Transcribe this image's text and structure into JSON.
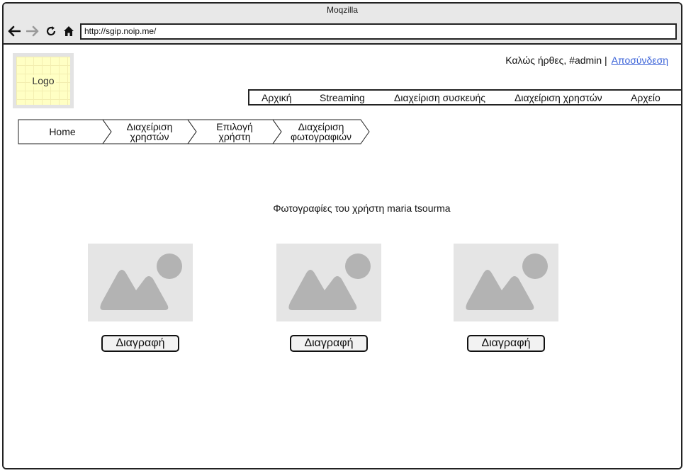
{
  "window": {
    "title": "Moqzilla"
  },
  "browser": {
    "url": "http://sgip.noip.me/"
  },
  "header": {
    "logo_label": "Logo",
    "welcome_text": "Καλώς ήρθες, #admin |",
    "logout_label": "Αποσύνδεση"
  },
  "menu": {
    "items": [
      {
        "label": "Αρχική"
      },
      {
        "label": "Streaming"
      },
      {
        "label": "Διαχείριση συσκευής"
      },
      {
        "label": "Διαχείριση χρηστών"
      },
      {
        "label": "Αρχείο"
      }
    ]
  },
  "breadcrumb": {
    "items": [
      {
        "line1": "Home",
        "line2": ""
      },
      {
        "line1": "Διαχείριση",
        "line2": "χρηστών"
      },
      {
        "line1": "Επιλογή",
        "line2": "χρήστη"
      },
      {
        "line1": "Διαχείριση",
        "line2": "φωτογραφιών"
      }
    ]
  },
  "main": {
    "heading": "Φωτογραφίες του χρήστη maria tsourma",
    "photos": [
      {
        "delete_label": "Διαγραφή"
      },
      {
        "delete_label": "Διαγραφή"
      },
      {
        "delete_label": "Διαγραφή"
      }
    ]
  },
  "icons": {
    "back": "arrow-left-icon",
    "forward": "arrow-right-icon",
    "reload": "reload-icon",
    "home": "home-icon",
    "image": "image-placeholder-icon"
  },
  "colors": {
    "link": "#3a62d8",
    "logo_note": "#ffffc4",
    "placeholder": "#e5e5e5",
    "placeholder_shape": "#b3b3b3"
  }
}
